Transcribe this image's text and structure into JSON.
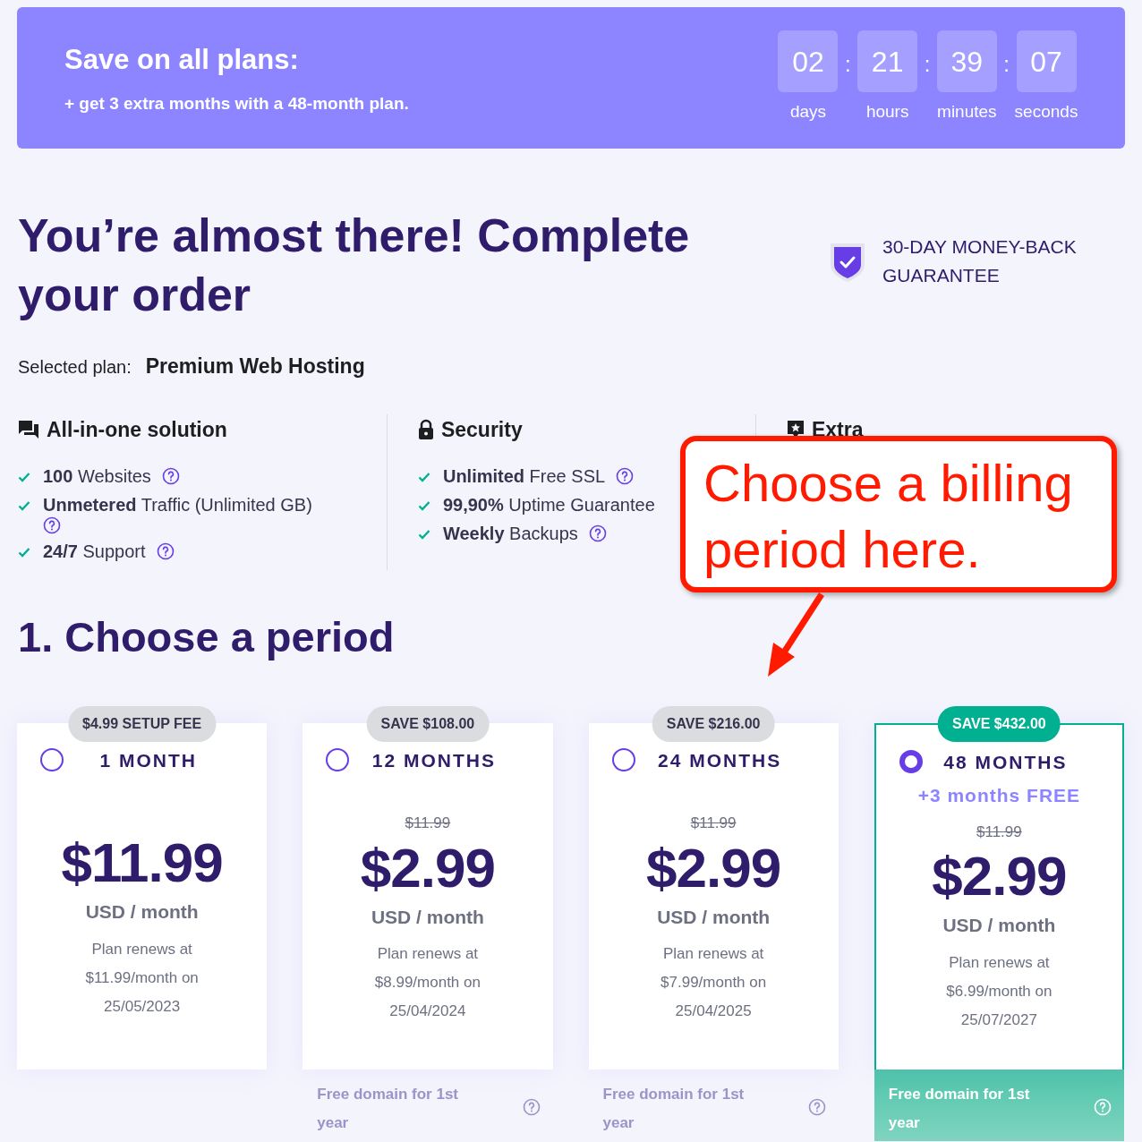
{
  "promo": {
    "title": "Save on all plans:",
    "subtitle": "+ get 3 extra months with a 48-month plan.",
    "separator": ":",
    "countdown": [
      {
        "value": "02",
        "unit": "days"
      },
      {
        "value": "21",
        "unit": "hours"
      },
      {
        "value": "39",
        "unit": "minutes"
      },
      {
        "value": "07",
        "unit": "seconds"
      }
    ]
  },
  "heading": "You’re almost there! Complete your order",
  "guarantee": "30-DAY MONEY-BACK GUARANTEE",
  "selected_plan": {
    "label": "Selected plan:",
    "value": "Premium Web Hosting"
  },
  "features": [
    {
      "title": "All-in-one solution",
      "items": [
        {
          "text": "**100** Websites",
          "help": true
        },
        {
          "text": "**Unmetered** Traffic (Unlimited GB)",
          "help": true
        },
        {
          "text": "**24/7** Support",
          "help": true
        }
      ]
    },
    {
      "title": "Security",
      "items": [
        {
          "text": "**Unlimited** Free SSL",
          "help": true
        },
        {
          "text": "**99,90%** Uptime Guarantee",
          "help": false
        },
        {
          "text": "**Weekly** Backups",
          "help": true
        }
      ]
    },
    {
      "title": "Extra"
    }
  ],
  "callout": "Choose a billing period here.",
  "period_title": "1. Choose a period",
  "plans": [
    {
      "badge": "$4.99 SETUP FEE",
      "duration": "1 MONTH",
      "price": "$11.99",
      "unit": "USD / month",
      "renewal": "Plan renews at $11.99/month on 25/05/2023",
      "selected": false
    },
    {
      "badge": "SAVE $108.00",
      "duration": "12 MONTHS",
      "old_price": "$11.99",
      "price": "$2.99",
      "unit": "USD / month",
      "renewal": "Plan renews at $8.99/month on 25/04/2024",
      "free_domain": "Free domain for 1st year",
      "selected": false
    },
    {
      "badge": "SAVE $216.00",
      "duration": "24 MONTHS",
      "old_price": "$11.99",
      "price": "$2.99",
      "unit": "USD / month",
      "renewal": "Plan renews at $7.99/month on 25/04/2025",
      "free_domain": "Free domain for 1st year",
      "selected": false
    },
    {
      "badge": "SAVE $432.00",
      "duration": "48 MONTHS",
      "bonus": "+3 months FREE",
      "old_price": "$11.99",
      "price": "$2.99",
      "unit": "USD / month",
      "renewal": "Plan renews at $6.99/month on 25/07/2027",
      "free_domain": "Free domain for 1st year",
      "selected": true
    }
  ]
}
